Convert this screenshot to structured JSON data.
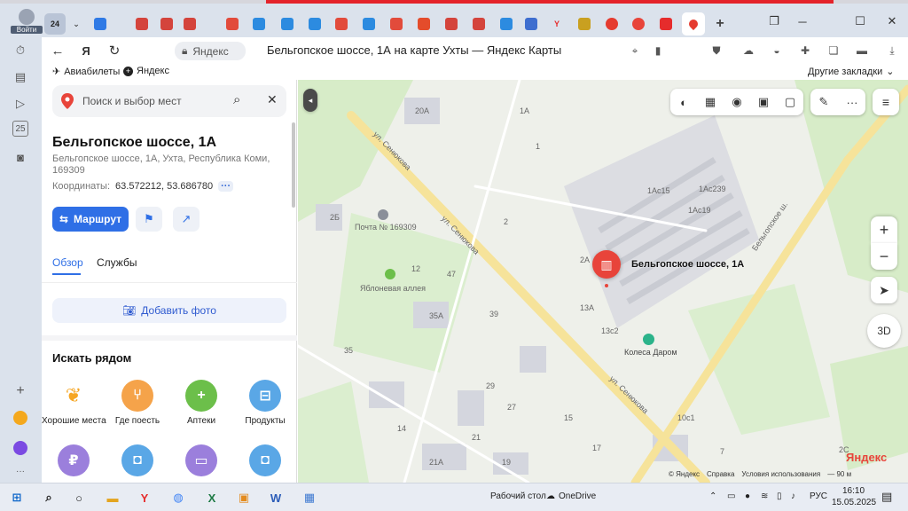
{
  "browser": {
    "profile_label": "Войти",
    "tab_count": "24",
    "page_title": "Бельгопское шоссе, 1А на карте Ухты — Яндекс Карты",
    "site_name": "Яндекс",
    "bookmarks": [
      "Авиабилеты",
      "Яндекс"
    ],
    "other_bookmarks": "Другие закладки"
  },
  "panel": {
    "search_placeholder": "Поиск и выбор мест",
    "place_title": "Бельгопское шоссе, 1А",
    "place_address": "Бельгопское шоссе, 1А, Ухта, Республика Коми, 169309",
    "coords_label": "Координаты:",
    "coords_value": "63.572212, 53.686780",
    "route_label": "Маршрут",
    "tabs": [
      "Обзор",
      "Службы"
    ],
    "add_photo": "Добавить фото",
    "nearby_title": "Искать рядом",
    "categories": [
      {
        "label": "Хорошие места",
        "icon": "good-places-icon",
        "color": "#f6a623"
      },
      {
        "label": "Где поесть",
        "icon": "food-icon",
        "color": "#f5a34a"
      },
      {
        "label": "Аптеки",
        "icon": "pharmacy-icon",
        "color": "#6cbf4a"
      },
      {
        "label": "Продукты",
        "icon": "basket-icon",
        "color": "#5aa7e6"
      },
      {
        "label": "",
        "icon": "ruble-icon",
        "color": "#9b7fdc"
      },
      {
        "label": "",
        "icon": "bag-icon",
        "color": "#5aa7e6"
      },
      {
        "label": "",
        "icon": "hotel-icon",
        "color": "#9b7fdc"
      },
      {
        "label": "",
        "icon": "bag-icon",
        "color": "#5aa7e6"
      }
    ]
  },
  "map": {
    "marker_label": "Бельгопское шоссе, 1А",
    "labels": {
      "street_senyukova_1": "ул. Сенюкова",
      "street_senyukova_2": "ул. Сенюкова",
      "street_senyukova_3": "ул. Сенюкова",
      "belgopskoe": "Бельгопское ш.",
      "post": "Почта № 169309",
      "apple_alley": "Яблоневая аллея",
      "kolesa": "Колеса Даром",
      "b_1ac15": "1Ac15",
      "b_1ac239": "1Ac239",
      "b_1ac19": "1Ac19",
      "b_1a": "1А",
      "b_2a": "2А",
      "b_13a": "13А",
      "b_13c2": "13с2",
      "b_2": "2",
      "b_12": "12",
      "b_47": "47",
      "b_39": "39",
      "b_35": "35",
      "b_29": "29",
      "b_27": "27",
      "b_21": "21",
      "b_21a": "21А",
      "b_19": "19",
      "b_14": "14",
      "b_10c1": "10с1",
      "b_7": "7",
      "b_20a": "20А",
      "b_35a": "35А",
      "b_2b": "2Б",
      "b_1": "1",
      "b_15": "15",
      "b_17": "17",
      "b_2c": "2С"
    },
    "footer": [
      "© Яндекс",
      "Справка",
      "Условия использования",
      "— 90 м"
    ],
    "logo": "Яндекс",
    "btn_3d": "3D"
  },
  "taskbar": {
    "desktop_label": "Рабочий стол",
    "onedrive": "OneDrive",
    "lang": "РУС",
    "time": "16:10",
    "date": "15.05.2025"
  }
}
